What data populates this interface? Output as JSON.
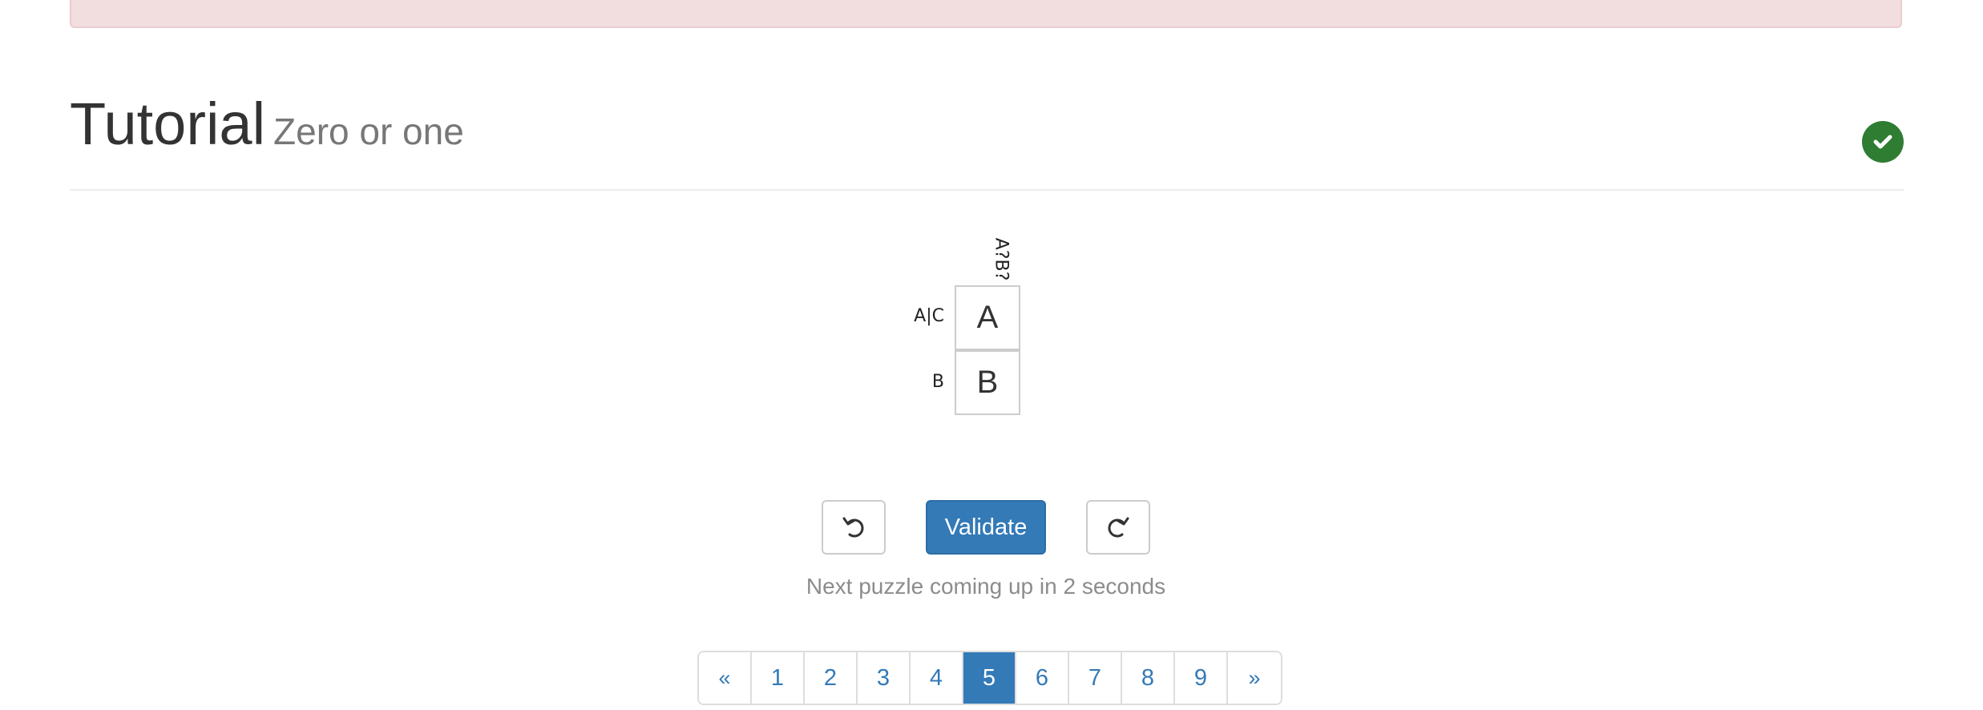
{
  "header": {
    "title": "Tutorial",
    "subtitle": "Zero or one",
    "solved_icon": "check-icon",
    "solved_color": "#2e7d32"
  },
  "puzzle": {
    "column_clues": [
      "A?B?"
    ],
    "row_clues": [
      "A|C",
      "B"
    ],
    "cells": [
      "A",
      "B"
    ]
  },
  "controls": {
    "undo_icon": "undo-icon",
    "validate_label": "Validate",
    "redo_icon": "redo-icon"
  },
  "status": {
    "message": "Next puzzle coming up in 2 seconds"
  },
  "pagination": {
    "prev_label": "«",
    "next_label": "»",
    "pages": [
      "1",
      "2",
      "3",
      "4",
      "5",
      "6",
      "7",
      "8",
      "9"
    ],
    "active_page": "5"
  },
  "colors": {
    "primary": "#337ab7",
    "alert_background": "#f2dede",
    "muted_text": "#8c8c8c"
  }
}
